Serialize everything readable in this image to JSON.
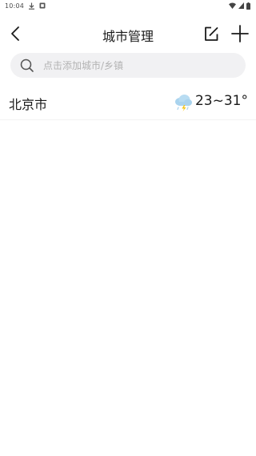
{
  "status_bar": {
    "time": "10:04",
    "icons": [
      "download-icon",
      "notification-icon",
      "wifi-icon",
      "signal-icon",
      "battery-icon"
    ]
  },
  "header": {
    "title": "城市管理",
    "back_icon": "chevron-left-icon",
    "edit_icon": "edit-icon",
    "add_icon": "plus-icon"
  },
  "search": {
    "placeholder": "点击添加城市/乡镇",
    "value": "",
    "icon": "search-icon"
  },
  "cities": [
    {
      "name": "北京市",
      "weather_icon": "thunderstorm-icon",
      "temperature": "23~31°"
    }
  ],
  "colors": {
    "background": "#ffffff",
    "search_background": "#f1f1f3",
    "text_primary": "#1a1a1a",
    "placeholder": "#b3b3b3",
    "cloud": "#a9d3ee",
    "lightning": "#f5c518"
  }
}
